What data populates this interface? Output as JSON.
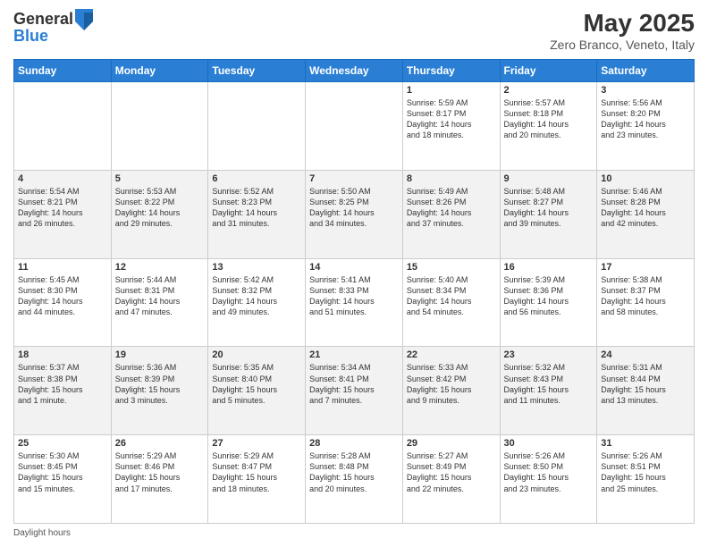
{
  "header": {
    "logo_line1": "General",
    "logo_line2": "Blue",
    "title": "May 2025",
    "subtitle": "Zero Branco, Veneto, Italy"
  },
  "days_of_week": [
    "Sunday",
    "Monday",
    "Tuesday",
    "Wednesday",
    "Thursday",
    "Friday",
    "Saturday"
  ],
  "weeks": [
    [
      {
        "day": "",
        "info": ""
      },
      {
        "day": "",
        "info": ""
      },
      {
        "day": "",
        "info": ""
      },
      {
        "day": "",
        "info": ""
      },
      {
        "day": "1",
        "info": "Sunrise: 5:59 AM\nSunset: 8:17 PM\nDaylight: 14 hours\nand 18 minutes."
      },
      {
        "day": "2",
        "info": "Sunrise: 5:57 AM\nSunset: 8:18 PM\nDaylight: 14 hours\nand 20 minutes."
      },
      {
        "day": "3",
        "info": "Sunrise: 5:56 AM\nSunset: 8:20 PM\nDaylight: 14 hours\nand 23 minutes."
      }
    ],
    [
      {
        "day": "4",
        "info": "Sunrise: 5:54 AM\nSunset: 8:21 PM\nDaylight: 14 hours\nand 26 minutes."
      },
      {
        "day": "5",
        "info": "Sunrise: 5:53 AM\nSunset: 8:22 PM\nDaylight: 14 hours\nand 29 minutes."
      },
      {
        "day": "6",
        "info": "Sunrise: 5:52 AM\nSunset: 8:23 PM\nDaylight: 14 hours\nand 31 minutes."
      },
      {
        "day": "7",
        "info": "Sunrise: 5:50 AM\nSunset: 8:25 PM\nDaylight: 14 hours\nand 34 minutes."
      },
      {
        "day": "8",
        "info": "Sunrise: 5:49 AM\nSunset: 8:26 PM\nDaylight: 14 hours\nand 37 minutes."
      },
      {
        "day": "9",
        "info": "Sunrise: 5:48 AM\nSunset: 8:27 PM\nDaylight: 14 hours\nand 39 minutes."
      },
      {
        "day": "10",
        "info": "Sunrise: 5:46 AM\nSunset: 8:28 PM\nDaylight: 14 hours\nand 42 minutes."
      }
    ],
    [
      {
        "day": "11",
        "info": "Sunrise: 5:45 AM\nSunset: 8:30 PM\nDaylight: 14 hours\nand 44 minutes."
      },
      {
        "day": "12",
        "info": "Sunrise: 5:44 AM\nSunset: 8:31 PM\nDaylight: 14 hours\nand 47 minutes."
      },
      {
        "day": "13",
        "info": "Sunrise: 5:42 AM\nSunset: 8:32 PM\nDaylight: 14 hours\nand 49 minutes."
      },
      {
        "day": "14",
        "info": "Sunrise: 5:41 AM\nSunset: 8:33 PM\nDaylight: 14 hours\nand 51 minutes."
      },
      {
        "day": "15",
        "info": "Sunrise: 5:40 AM\nSunset: 8:34 PM\nDaylight: 14 hours\nand 54 minutes."
      },
      {
        "day": "16",
        "info": "Sunrise: 5:39 AM\nSunset: 8:36 PM\nDaylight: 14 hours\nand 56 minutes."
      },
      {
        "day": "17",
        "info": "Sunrise: 5:38 AM\nSunset: 8:37 PM\nDaylight: 14 hours\nand 58 minutes."
      }
    ],
    [
      {
        "day": "18",
        "info": "Sunrise: 5:37 AM\nSunset: 8:38 PM\nDaylight: 15 hours\nand 1 minute."
      },
      {
        "day": "19",
        "info": "Sunrise: 5:36 AM\nSunset: 8:39 PM\nDaylight: 15 hours\nand 3 minutes."
      },
      {
        "day": "20",
        "info": "Sunrise: 5:35 AM\nSunset: 8:40 PM\nDaylight: 15 hours\nand 5 minutes."
      },
      {
        "day": "21",
        "info": "Sunrise: 5:34 AM\nSunset: 8:41 PM\nDaylight: 15 hours\nand 7 minutes."
      },
      {
        "day": "22",
        "info": "Sunrise: 5:33 AM\nSunset: 8:42 PM\nDaylight: 15 hours\nand 9 minutes."
      },
      {
        "day": "23",
        "info": "Sunrise: 5:32 AM\nSunset: 8:43 PM\nDaylight: 15 hours\nand 11 minutes."
      },
      {
        "day": "24",
        "info": "Sunrise: 5:31 AM\nSunset: 8:44 PM\nDaylight: 15 hours\nand 13 minutes."
      }
    ],
    [
      {
        "day": "25",
        "info": "Sunrise: 5:30 AM\nSunset: 8:45 PM\nDaylight: 15 hours\nand 15 minutes."
      },
      {
        "day": "26",
        "info": "Sunrise: 5:29 AM\nSunset: 8:46 PM\nDaylight: 15 hours\nand 17 minutes."
      },
      {
        "day": "27",
        "info": "Sunrise: 5:29 AM\nSunset: 8:47 PM\nDaylight: 15 hours\nand 18 minutes."
      },
      {
        "day": "28",
        "info": "Sunrise: 5:28 AM\nSunset: 8:48 PM\nDaylight: 15 hours\nand 20 minutes."
      },
      {
        "day": "29",
        "info": "Sunrise: 5:27 AM\nSunset: 8:49 PM\nDaylight: 15 hours\nand 22 minutes."
      },
      {
        "day": "30",
        "info": "Sunrise: 5:26 AM\nSunset: 8:50 PM\nDaylight: 15 hours\nand 23 minutes."
      },
      {
        "day": "31",
        "info": "Sunrise: 5:26 AM\nSunset: 8:51 PM\nDaylight: 15 hours\nand 25 minutes."
      }
    ]
  ],
  "footer": {
    "text": "Daylight hours"
  }
}
